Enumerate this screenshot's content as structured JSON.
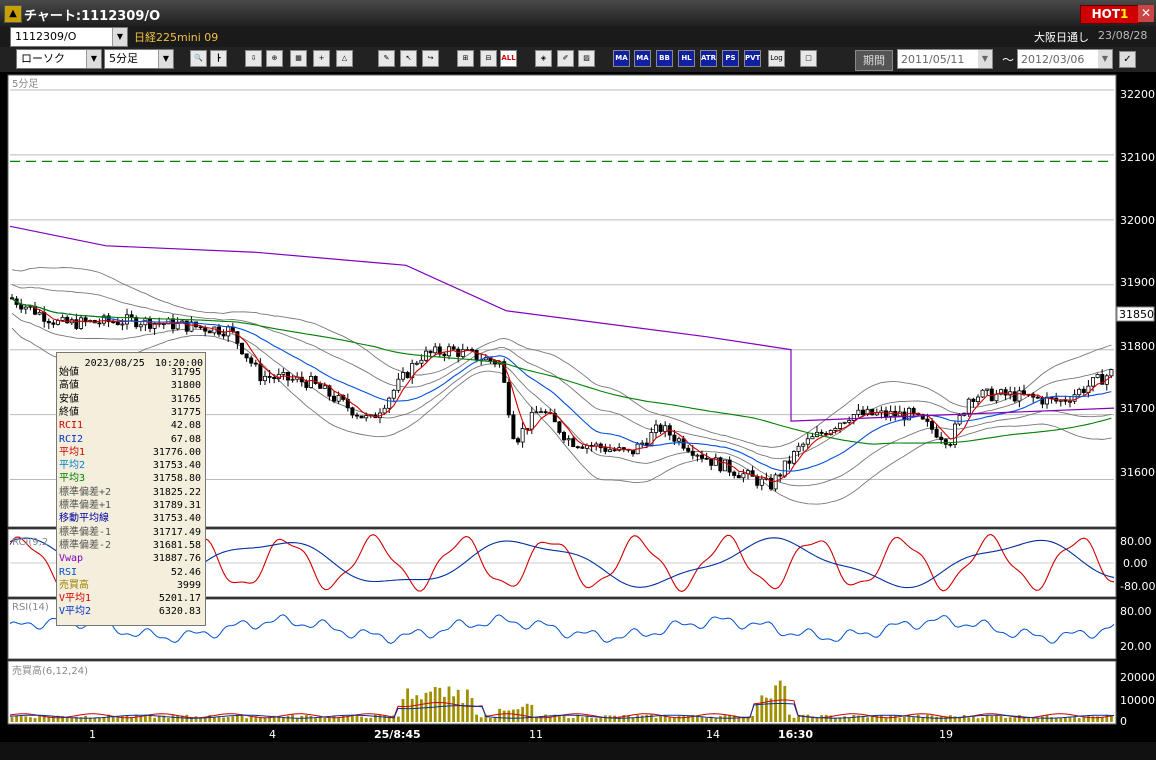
{
  "window": {
    "title": "チャート:1112309/O",
    "hot_label": "HOT",
    "hot_num": "1",
    "close": "✕"
  },
  "symbol": {
    "code": "1112309/O",
    "name": "日経225mini 09",
    "market": "大阪日通し",
    "date": "23/08/28"
  },
  "toolbar": {
    "chart_type": "ローソク",
    "interval": "5分足",
    "buttons": [
      "🔍",
      "┣",
      "⇩",
      "⊕",
      "▦",
      "+",
      "△",
      "✎",
      "↖",
      "↪",
      "⊞",
      "⊟",
      "ALL",
      "◈",
      "✐",
      "▨",
      "MA",
      "MA",
      "BB",
      "HL",
      "ATR",
      "PS",
      "PVT",
      "Log",
      "□"
    ],
    "period_label": "期間",
    "date_from": "2011/05/11",
    "date_to": "2012/03/06",
    "tilde": "〜",
    "check": "✓"
  },
  "panels": {
    "main_label": "5分足",
    "rci_label": "RCI(9,2",
    "rsi_label": "RSI(14)",
    "vol_label": "売買高(6,12,24)"
  },
  "price_axis": {
    "ticks": [
      "32200",
      "32100",
      "32000",
      "31900",
      "31850",
      "31800",
      "31700",
      "31600"
    ],
    "current": "31850"
  },
  "rci_axis": [
    "80.00",
    "0.00",
    "-80.00"
  ],
  "rsi_axis": [
    "80.00",
    "20.00"
  ],
  "vol_axis": [
    "20000",
    "10000",
    "0"
  ],
  "time_axis": [
    "1",
    "4",
    "25/8:45",
    "11",
    "14",
    "16:30",
    "19"
  ],
  "info": {
    "datetime": "2023/08/25　10:20:00",
    "rows": [
      {
        "k": "始値",
        "v": "31795",
        "c": "#000"
      },
      {
        "k": "高値",
        "v": "31800",
        "c": "#000"
      },
      {
        "k": "安値",
        "v": "31765",
        "c": "#000"
      },
      {
        "k": "終値",
        "v": "31775",
        "c": "#000"
      },
      {
        "k": "RCI1",
        "v": "42.08",
        "c": "#d00000"
      },
      {
        "k": "RCI2",
        "v": "67.08",
        "c": "#0030d0"
      },
      {
        "k": "平均1",
        "v": "31776.00",
        "c": "#d00000"
      },
      {
        "k": "平均2",
        "v": "31753.40",
        "c": "#0080d0"
      },
      {
        "k": "平均3",
        "v": "31758.80",
        "c": "#008000"
      },
      {
        "k": "標準偏差+2",
        "v": "31825.22",
        "c": "#555"
      },
      {
        "k": "標準偏差+1",
        "v": "31789.31",
        "c": "#555"
      },
      {
        "k": "移動平均線",
        "v": "31753.40",
        "c": "#0000a0"
      },
      {
        "k": "標準偏差-1",
        "v": "31717.49",
        "c": "#555"
      },
      {
        "k": "標準偏差-2",
        "v": "31681.58",
        "c": "#555"
      },
      {
        "k": "Vwap",
        "v": "31887.76",
        "c": "#8000c0"
      },
      {
        "k": "RSI",
        "v": "52.46",
        "c": "#0050d0"
      },
      {
        "k": "売買高",
        "v": "3999",
        "c": "#a08000"
      },
      {
        "k": "V平均1",
        "v": "5201.17",
        "c": "#d00000"
      },
      {
        "k": "V平均2",
        "v": "6320.83",
        "c": "#0030d0"
      }
    ]
  },
  "chart_data": {
    "type": "candlestick",
    "interval": "5分足",
    "ylim": [
      31530,
      32220
    ],
    "reference_line": 32090,
    "vwap_jump": {
      "from": 31800,
      "to": 31690
    },
    "rci_range": [
      -100,
      100
    ],
    "rsi_range": [
      0,
      100
    ],
    "volume_max": 20000,
    "colors": {
      "up": "#ffffff",
      "down": "#000000",
      "ma1": "#d00000",
      "ma2": "#0050e0",
      "ma3": "#008000",
      "vwap": "#8000c0",
      "band": "#777777",
      "rci1": "#d00000",
      "rci2": "#0030a0",
      "rsi": "#0050d0",
      "vol": "#a09000",
      "ref": "#008000"
    }
  }
}
